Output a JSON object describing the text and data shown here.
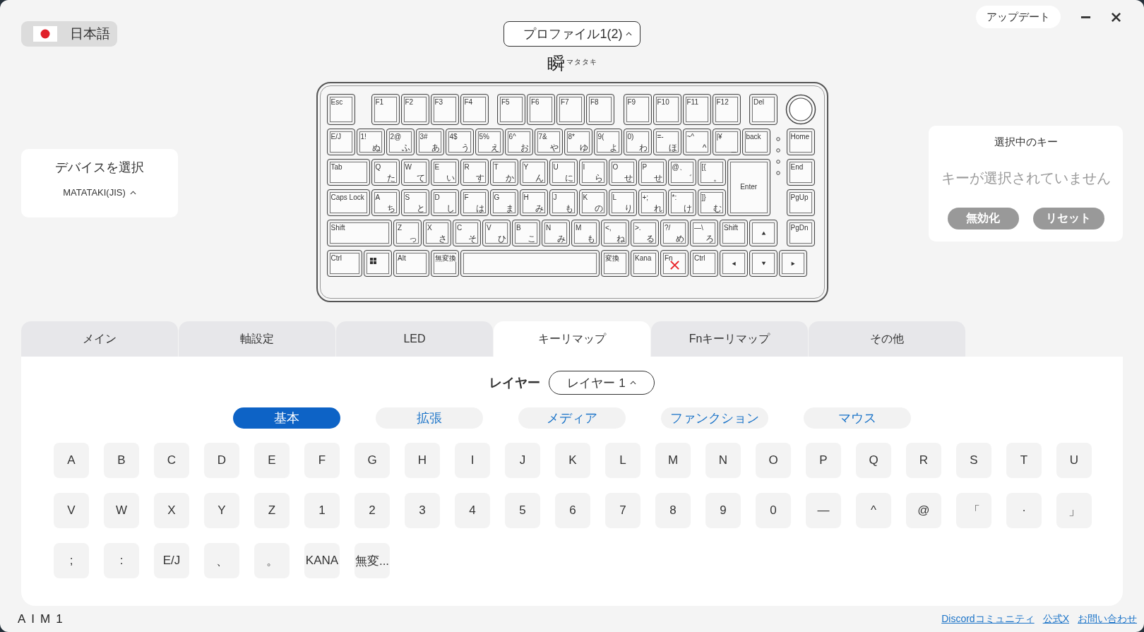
{
  "language": {
    "label": "日本語"
  },
  "profile": {
    "label": "プロファイル1(2)"
  },
  "logo": {
    "mark": "瞬",
    "ruby": "マタタキ"
  },
  "window_controls": {
    "update": "アップデート"
  },
  "device": {
    "title": "デバイスを選択",
    "value": "MATATAKI(JIS)"
  },
  "keyboard": {
    "rows": [
      {
        "keys": [
          {
            "label": "Esc",
            "kind": "key",
            "locked": false
          },
          {
            "label": "F1",
            "kind": "key",
            "locked": false
          },
          {
            "label": "F2",
            "kind": "key",
            "locked": false
          },
          {
            "label": "F3",
            "kind": "key",
            "locked": false
          },
          {
            "label": "F4",
            "kind": "key",
            "locked": false
          },
          {
            "label": "F5",
            "kind": "key",
            "locked": false
          },
          {
            "label": "F6",
            "kind": "key",
            "locked": false
          },
          {
            "label": "F7",
            "kind": "key",
            "locked": false
          },
          {
            "label": "F8",
            "kind": "key",
            "locked": false
          },
          {
            "label": "F9",
            "kind": "key",
            "locked": false
          },
          {
            "label": "F10",
            "kind": "key",
            "locked": false
          },
          {
            "label": "F11",
            "kind": "key",
            "locked": false
          },
          {
            "label": "F12",
            "kind": "key",
            "locked": false
          },
          {
            "label": "Del",
            "kind": "key",
            "locked": false
          }
        ]
      },
      {
        "keys": [
          {
            "label": "E/J",
            "kind": "key",
            "locked": false
          },
          {
            "label": "1!",
            "kana": "ぬ",
            "kind": "key",
            "locked": false
          },
          {
            "label": "2@",
            "kana": "ふ",
            "kind": "key",
            "locked": false
          },
          {
            "label": "3#",
            "kana": "あ",
            "kind": "key",
            "locked": false
          },
          {
            "label": "4$",
            "kana": "う",
            "kind": "key",
            "locked": false
          },
          {
            "label": "5%",
            "kana": "え",
            "kind": "key",
            "locked": false
          },
          {
            "label": "6^",
            "kana": "お",
            "kind": "key",
            "locked": false
          },
          {
            "label": "7&",
            "kana": "や",
            "kind": "key",
            "locked": false
          },
          {
            "label": "8*",
            "kana": "ゆ",
            "kind": "key",
            "locked": false
          },
          {
            "label": "9(",
            "kana": "よ",
            "kind": "key",
            "locked": false
          },
          {
            "label": "0)",
            "kana": "わ",
            "kind": "key",
            "locked": false
          },
          {
            "label": "=-",
            "kana": "ほ",
            "kind": "key",
            "locked": false
          },
          {
            "label": "~^",
            "kana": "^",
            "kind": "key",
            "locked": false
          },
          {
            "label": "|¥",
            "kana": "_",
            "kind": "key",
            "locked": false
          },
          {
            "label": "back",
            "kind": "key",
            "locked": false
          },
          {
            "label": "Home",
            "kind": "nav",
            "locked": false
          }
        ]
      },
      {
        "keys": [
          {
            "label": "Tab",
            "kind": "tab",
            "locked": false
          },
          {
            "label": "Q",
            "kana": "た",
            "kind": "key",
            "locked": false
          },
          {
            "label": "W",
            "kana": "て",
            "kind": "key",
            "locked": false
          },
          {
            "label": "E",
            "kana": "い",
            "kind": "key",
            "locked": false
          },
          {
            "label": "R",
            "kana": "す",
            "kind": "key",
            "locked": false
          },
          {
            "label": "T",
            "kana": "か",
            "kind": "key",
            "locked": false
          },
          {
            "label": "Y",
            "kana": "ん",
            "kind": "key",
            "locked": false
          },
          {
            "label": "U",
            "kana": "に",
            "kind": "key",
            "locked": false
          },
          {
            "label": "I",
            "kana": "ら",
            "kind": "key",
            "locked": false
          },
          {
            "label": "O",
            "kana": "せ",
            "kind": "key",
            "locked": false
          },
          {
            "label": "P",
            "kana": "せ",
            "kind": "key",
            "locked": false
          },
          {
            "label": "@、",
            "kana": "゛",
            "kind": "key",
            "locked": false
          },
          {
            "label": "[{",
            "kana": "。",
            "kind": "key",
            "locked": false
          },
          {
            "label": "Enter",
            "kind": "enter",
            "locked": false
          },
          {
            "label": "End",
            "kind": "nav",
            "locked": false
          }
        ]
      },
      {
        "keys": [
          {
            "label": "Caps Lock",
            "kind": "caps",
            "locked": false
          },
          {
            "label": "A",
            "kana": "ち",
            "kind": "key",
            "locked": false
          },
          {
            "label": "S",
            "kana": "と",
            "kind": "key",
            "locked": false
          },
          {
            "label": "D",
            "kana": "し",
            "kind": "key",
            "locked": false
          },
          {
            "label": "F",
            "kana": "は",
            "kind": "key",
            "locked": false
          },
          {
            "label": "G",
            "kana": "ま",
            "kind": "key",
            "locked": false
          },
          {
            "label": "H",
            "kana": "み",
            "kind": "key",
            "locked": false
          },
          {
            "label": "J",
            "kana": "も",
            "kind": "key",
            "locked": false
          },
          {
            "label": "K",
            "kana": "の",
            "kind": "key",
            "locked": false
          },
          {
            "label": "L",
            "kana": "り",
            "kind": "key",
            "locked": false
          },
          {
            "label": "+;",
            "kana": "れ",
            "kind": "key",
            "locked": false
          },
          {
            "label": "*:",
            "kana": "け",
            "kind": "key",
            "locked": false
          },
          {
            "label": "]}",
            "kana": "む",
            "kind": "key",
            "locked": false
          },
          {
            "label": "PgUp",
            "kind": "nav",
            "locked": false
          }
        ]
      },
      {
        "keys": [
          {
            "label": "Shift",
            "kind": "lshift",
            "locked": false
          },
          {
            "label": "Z",
            "kana": "っ",
            "kind": "key",
            "locked": false
          },
          {
            "label": "X",
            "kana": "さ",
            "kind": "key",
            "locked": false
          },
          {
            "label": "C",
            "kana": "そ",
            "kind": "key",
            "locked": false
          },
          {
            "label": "V",
            "kana": "ひ",
            "kind": "key",
            "locked": false
          },
          {
            "label": "B",
            "kana": "こ",
            "kind": "key",
            "locked": false
          },
          {
            "label": "N",
            "kana": "み",
            "kind": "key",
            "locked": false
          },
          {
            "label": "M",
            "kana": "も",
            "kind": "key",
            "locked": false
          },
          {
            "label": "<,",
            "kana": "ね",
            "kind": "key",
            "locked": false
          },
          {
            "label": ">.",
            "kana": "る",
            "kind": "key",
            "locked": false
          },
          {
            "label": "?/",
            "kana": "め",
            "kind": "key",
            "locked": false
          },
          {
            "label": "—\\",
            "kana": "ろ",
            "kind": "key",
            "locked": false
          },
          {
            "label": "Shift",
            "kind": "key",
            "locked": false
          },
          {
            "kind": "arrow-up",
            "locked": false
          },
          {
            "label": "PgDn",
            "kind": "nav",
            "locked": false
          }
        ]
      },
      {
        "keys": [
          {
            "label": "Ctrl",
            "kind": "ctrl",
            "locked": false
          },
          {
            "kind": "win",
            "locked": false
          },
          {
            "label": "Alt",
            "kind": "alt",
            "locked": false
          },
          {
            "label": "無変換",
            "kind": "key",
            "locked": false
          },
          {
            "kind": "space",
            "locked": false
          },
          {
            "label": "変換",
            "kind": "key",
            "locked": false
          },
          {
            "label": "Kana",
            "kind": "key",
            "locked": false
          },
          {
            "label": "Fn",
            "kind": "key",
            "locked": true
          },
          {
            "label": "Ctrl",
            "kind": "key",
            "locked": false
          },
          {
            "kind": "arrow-left",
            "locked": false
          },
          {
            "kind": "arrow-down",
            "locked": false
          },
          {
            "kind": "arrow-right",
            "locked": false
          }
        ]
      }
    ]
  },
  "selected_key_panel": {
    "title": "選択中のキー",
    "message": "キーが選択されていません",
    "buttons": [
      "無効化",
      "リセット"
    ]
  },
  "tabs": [
    {
      "label": "メイン",
      "selected": false
    },
    {
      "label": "軸設定",
      "selected": false
    },
    {
      "label": "LED",
      "selected": false
    },
    {
      "label": "キーリマップ",
      "selected": true
    },
    {
      "label": "Fnキーリマップ",
      "selected": false
    },
    {
      "label": "その他",
      "selected": false
    }
  ],
  "layer": {
    "label": "レイヤー",
    "value": "レイヤー 1"
  },
  "categories": [
    {
      "label": "基本",
      "selected": true
    },
    {
      "label": "拡張",
      "selected": false
    },
    {
      "label": "メディア",
      "selected": false
    },
    {
      "label": "ファンクション",
      "selected": false
    },
    {
      "label": "マウス",
      "selected": false
    }
  ],
  "palette": [
    "A",
    "B",
    "C",
    "D",
    "E",
    "F",
    "G",
    "H",
    "I",
    "J",
    "K",
    "L",
    "M",
    "N",
    "O",
    "P",
    "Q",
    "R",
    "S",
    "T",
    "U",
    "V",
    "W",
    "X",
    "Y",
    "Z",
    "1",
    "2",
    "3",
    "4",
    "5",
    "6",
    "7",
    "8",
    "9",
    "0",
    "—",
    "^",
    "@",
    "「",
    "·",
    "」",
    ";",
    ":",
    "E/J",
    "、",
    "。",
    "KANA",
    "無変..."
  ],
  "footer": {
    "logo": "AIM1",
    "links": [
      "Discordコミュニティ",
      "公式X",
      "お問い合わせ"
    ]
  }
}
